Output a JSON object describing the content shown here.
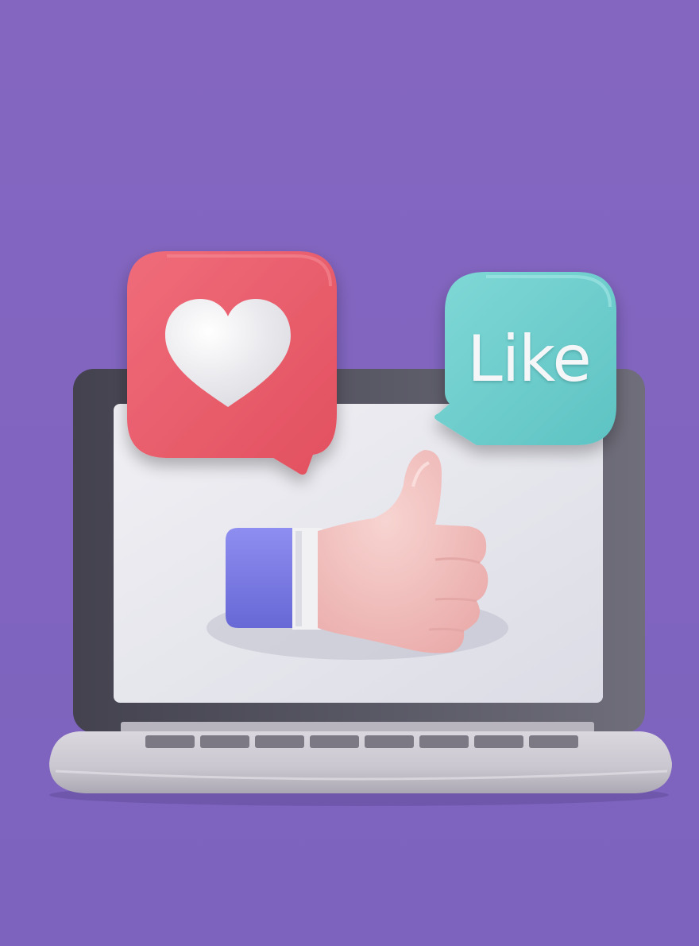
{
  "scene": {
    "background_color": "#7f66bf",
    "objects": {
      "laptop": {
        "icon": "laptop-icon",
        "bezel_color": "#4f4e5b",
        "screen_color": "#e4e4ec",
        "base_color": "#c9c6cf"
      },
      "heart_bubble": {
        "icon": "heart-icon",
        "bubble_color": "#ea5a6d",
        "heart_color": "#f2f2f5"
      },
      "like_bubble": {
        "icon": "speech-bubble-icon",
        "bubble_color": "#6fcfcf",
        "label": "Like"
      },
      "thumbs_up_hand": {
        "icon": "thumbs-up-icon",
        "sleeve_color": "#7b7ae6",
        "cuff_color": "#f1f1f4",
        "skin_color": "#f3c5c2"
      }
    }
  }
}
